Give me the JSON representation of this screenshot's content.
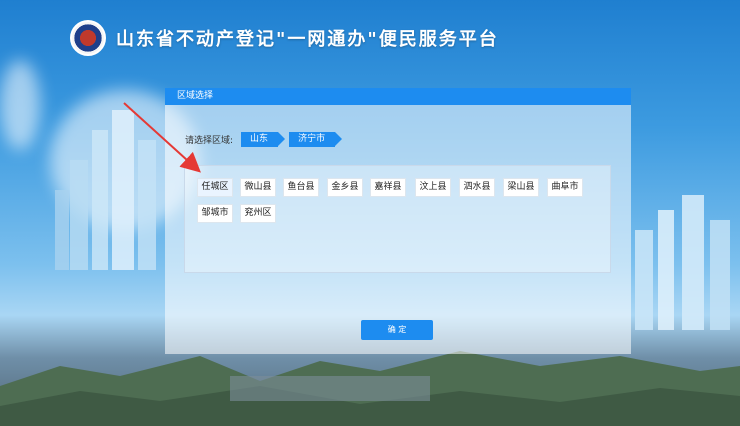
{
  "header": {
    "title": "山东省不动产登记\"一网通办\"便民服务平台"
  },
  "dialog": {
    "title": "区域选择",
    "region_label": "请选择区域:",
    "breadcrumbs": [
      "山东",
      "济宁市"
    ],
    "items": [
      "任城区",
      "微山县",
      "鱼台县",
      "金乡县",
      "嘉祥县",
      "汶上县",
      "泗水县",
      "梁山县",
      "曲阜市",
      "邹城市",
      "兖州区"
    ],
    "confirm_label": "确 定"
  },
  "colors": {
    "accent": "#1d8cf0",
    "arrow": "#e53935"
  }
}
